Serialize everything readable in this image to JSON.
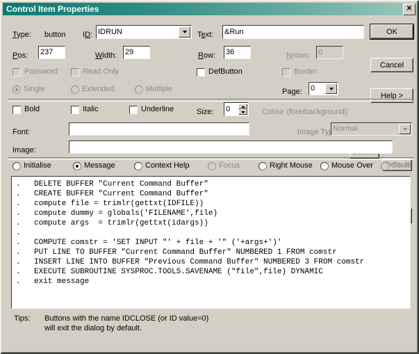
{
  "window": {
    "title": "Control Item Properties",
    "close_label": "✕",
    "titlebar_color_start": "#0b7b72",
    "titlebar_color_end": "#9fc7bd",
    "face_color": "#d4cfc4"
  },
  "row_type": {
    "type_label": "Type:",
    "type_value": "button",
    "id_label": "ID:",
    "id_value": "IDRUN",
    "text_label": "Text:",
    "text_value": "&Run"
  },
  "row_pos": {
    "pos_label": "Pos:",
    "pos_value": "237",
    "width_label": "Width:",
    "width_value": "29",
    "row_label": "Row:",
    "row_value": "36",
    "nrows_label": "Nrows:",
    "nrows_value": "0"
  },
  "checkboxes": {
    "password": "Password",
    "readonly": "Read Only",
    "defbutton": "DefButton",
    "border": "Border"
  },
  "selection_radios": {
    "single": "Single",
    "extended": "Extended",
    "multiple": "Multiple"
  },
  "page": {
    "label": "Page:",
    "value": "0"
  },
  "font_row": {
    "bold": "Bold",
    "italic": "Italic",
    "underline": "Underline",
    "size_label": "Size:",
    "size_value": "0",
    "colour_label": "Colour (fore/background):",
    "default_fore": "Default",
    "default_back": "Default",
    "font_label": "Font:",
    "font_value": "",
    "image_label": "Image:",
    "image_value": "",
    "image_type_label": "Image Type:",
    "image_type_value": "Normal",
    "browse_label": "»"
  },
  "buttons": {
    "ok": "OK",
    "cancel": "Cancel",
    "help": "Help >"
  },
  "event_radios": [
    {
      "label": "Initialise",
      "checked": false,
      "disabled": false
    },
    {
      "label": "Message",
      "checked": true,
      "disabled": false
    },
    {
      "label": "Context Help",
      "checked": false,
      "disabled": false
    },
    {
      "label": "Focus",
      "checked": false,
      "disabled": true
    },
    {
      "label": "Right Mouse",
      "checked": false,
      "disabled": false
    },
    {
      "label": "Mouse Over",
      "checked": false,
      "disabled": false
    },
    {
      "label": "Scroll",
      "checked": false,
      "disabled": true
    }
  ],
  "code": {
    "lines": [
      ".    DELETE BUFFER \"Current Command Buffer\"",
      ".    CREATE BUFFER \"Current Command Buffer\"",
      ".    compute file = trimlr(gettxt(IDFILE))",
      ".    compute dummy = globals('FILENAME',file)",
      ".    compute args  = trimlr(gettxt(idargs))",
      ".",
      ".    COMPUTE comstr = 'SET INPUT \"' + file + '\" ('+args+')'",
      ".    PUT LINE TO BUFFER \"Current Command Buffer\" NUMBERED 1 FROM comstr",
      ".    INSERT LINE INTO BUFFER \"Previous Command Buffer\" NUMBERED 3 FROM comstr",
      ".    EXECUTE SUBROUTINE SYSPROC.TOOLS.SAVENAME (\"file\",file) DYNAMIC",
      ".    exit message"
    ]
  },
  "tips": {
    "label": "Tips:",
    "line1": "Buttons with the name IDCLOSE (or ID value=0)",
    "line2": "will exit the dialog by default."
  }
}
